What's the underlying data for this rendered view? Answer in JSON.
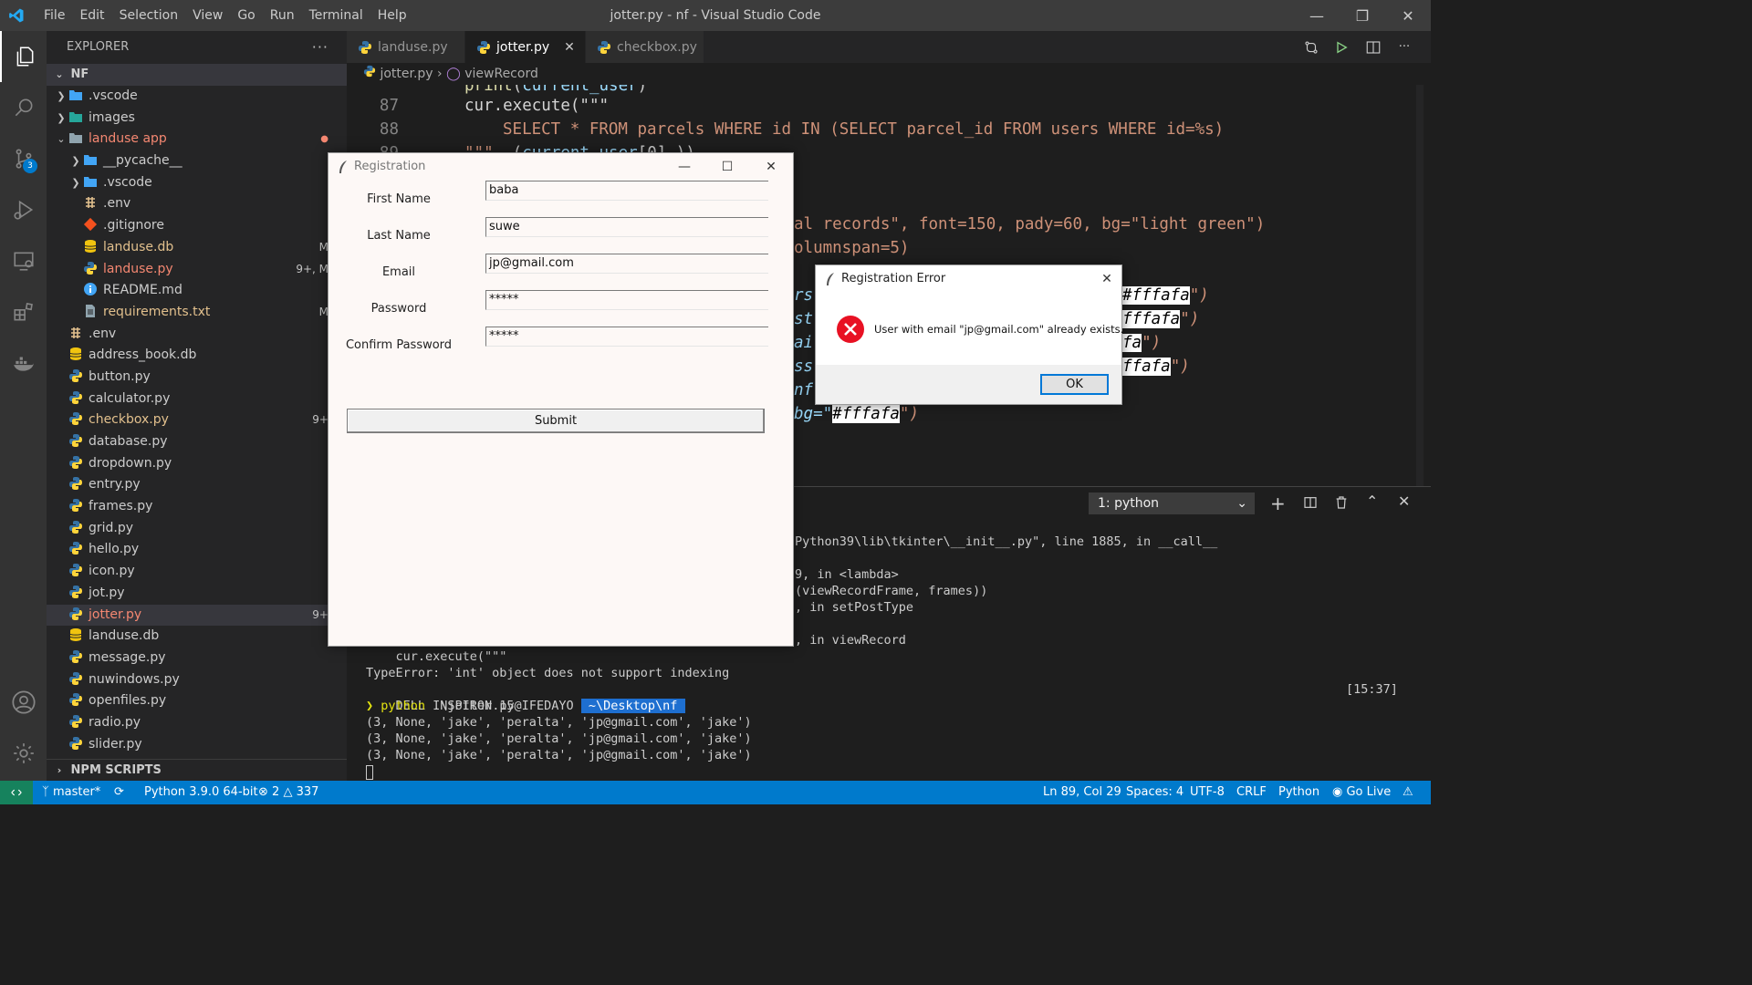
{
  "titlebar": {
    "menu": [
      "File",
      "Edit",
      "Selection",
      "View",
      "Go",
      "Run",
      "Terminal",
      "Help"
    ],
    "title": "jotter.py - nf - Visual Studio Code"
  },
  "activitybar": {
    "scm_badge": "3"
  },
  "sidebar": {
    "header": "EXPLORER",
    "root": "NF",
    "items": [
      {
        "name": ".vscode",
        "kind": "folder-blue",
        "depth": 1,
        "chev": "right",
        "color": "normal",
        "status": ""
      },
      {
        "name": "images",
        "kind": "folder-green",
        "depth": 1,
        "chev": "right",
        "color": "normal",
        "status": ""
      },
      {
        "name": "landuse app",
        "kind": "folder",
        "depth": 1,
        "chev": "down",
        "color": "red",
        "status": "dot"
      },
      {
        "name": "__pycache__",
        "kind": "folder-blue",
        "depth": 2,
        "chev": "right",
        "color": "normal",
        "status": ""
      },
      {
        "name": ".vscode",
        "kind": "folder-blue",
        "depth": 2,
        "chev": "right",
        "color": "normal",
        "status": ""
      },
      {
        "name": ".env",
        "kind": "env",
        "depth": 2,
        "chev": "",
        "color": "normal",
        "status": ""
      },
      {
        "name": ".gitignore",
        "kind": "git",
        "depth": 2,
        "chev": "",
        "color": "normal",
        "status": ""
      },
      {
        "name": "landuse.db",
        "kind": "db",
        "depth": 2,
        "chev": "",
        "color": "yellow",
        "status": "M"
      },
      {
        "name": "landuse.py",
        "kind": "py",
        "depth": 2,
        "chev": "",
        "color": "red",
        "status": "9+, M"
      },
      {
        "name": "README.md",
        "kind": "info",
        "depth": 2,
        "chev": "",
        "color": "normal",
        "status": ""
      },
      {
        "name": "requirements.txt",
        "kind": "txt",
        "depth": 2,
        "chev": "",
        "color": "yellow",
        "status": "M"
      },
      {
        "name": ".env",
        "kind": "env",
        "depth": 1,
        "chev": "",
        "color": "normal",
        "status": ""
      },
      {
        "name": "address_book.db",
        "kind": "db",
        "depth": 1,
        "chev": "",
        "color": "normal",
        "status": ""
      },
      {
        "name": "button.py",
        "kind": "py",
        "depth": 1,
        "chev": "",
        "color": "normal",
        "status": ""
      },
      {
        "name": "calculator.py",
        "kind": "py",
        "depth": 1,
        "chev": "",
        "color": "normal",
        "status": ""
      },
      {
        "name": "checkbox.py",
        "kind": "py",
        "depth": 1,
        "chev": "",
        "color": "yellow",
        "status": "9+"
      },
      {
        "name": "database.py",
        "kind": "py",
        "depth": 1,
        "chev": "",
        "color": "normal",
        "status": ""
      },
      {
        "name": "dropdown.py",
        "kind": "py",
        "depth": 1,
        "chev": "",
        "color": "normal",
        "status": ""
      },
      {
        "name": "entry.py",
        "kind": "py",
        "depth": 1,
        "chev": "",
        "color": "normal",
        "status": ""
      },
      {
        "name": "frames.py",
        "kind": "py",
        "depth": 1,
        "chev": "",
        "color": "normal",
        "status": ""
      },
      {
        "name": "grid.py",
        "kind": "py",
        "depth": 1,
        "chev": "",
        "color": "normal",
        "status": ""
      },
      {
        "name": "hello.py",
        "kind": "py",
        "depth": 1,
        "chev": "",
        "color": "normal",
        "status": ""
      },
      {
        "name": "icon.py",
        "kind": "py",
        "depth": 1,
        "chev": "",
        "color": "normal",
        "status": ""
      },
      {
        "name": "jot.py",
        "kind": "py",
        "depth": 1,
        "chev": "",
        "color": "normal",
        "status": ""
      },
      {
        "name": "jotter.py",
        "kind": "py",
        "depth": 1,
        "chev": "",
        "color": "red",
        "status": "9+",
        "selected": true
      },
      {
        "name": "landuse.db",
        "kind": "db",
        "depth": 1,
        "chev": "",
        "color": "normal",
        "status": ""
      },
      {
        "name": "message.py",
        "kind": "py",
        "depth": 1,
        "chev": "",
        "color": "normal",
        "status": ""
      },
      {
        "name": "nuwindows.py",
        "kind": "py",
        "depth": 1,
        "chev": "",
        "color": "normal",
        "status": ""
      },
      {
        "name": "openfiles.py",
        "kind": "py",
        "depth": 1,
        "chev": "",
        "color": "normal",
        "status": ""
      },
      {
        "name": "radio.py",
        "kind": "py",
        "depth": 1,
        "chev": "",
        "color": "normal",
        "status": ""
      },
      {
        "name": "slider.py",
        "kind": "py",
        "depth": 1,
        "chev": "",
        "color": "normal",
        "status": ""
      }
    ],
    "npm_section": "NPM SCRIPTS"
  },
  "tabs": [
    {
      "label": "landuse.py",
      "active": false
    },
    {
      "label": "jotter.py",
      "active": true
    },
    {
      "label": "checkbox.py",
      "active": false
    }
  ],
  "breadcrumb": {
    "file": "jotter.py",
    "symbol": "viewRecord"
  },
  "code": {
    "line87_num": "87",
    "line88_num": "88",
    "line89_num": "89",
    "line87": "cur.execute(\"\"\"",
    "line88": "SELECT * FROM parcels WHERE id IN (SELECT parcel_id FROM users WHERE id=%s)",
    "frag_records": "al records\", font=150, pady=60, bg=\"light green\")",
    "frag_colspan": "olumnspan=5)",
    "frag_hex": "#fffafa",
    "frag_bg": "bg=\"",
    "frag_bg_end": "\")"
  },
  "terminal": {
    "selector": "1: python",
    "lines": [
      "Python39\\lib\\tkinter\\__init__.py\", line 1885, in __call__",
      "9, in <lambda>",
      "(viewRecordFrame, frames))",
      ", in setPostType",
      ", in viewRecord",
      "    cur.execute(\"\"\"",
      "TypeError: 'int' object does not support indexing"
    ],
    "prompt_user": "DELL INSPIRON 15@IFEDAYO",
    "prompt_path": " ~\\Desktop\\nf ",
    "time": "[15:37]",
    "command": "python .\\jotter.py",
    "outputs": [
      "(3, None, 'jake', 'peralta', 'jp@gmail.com', 'jake')",
      "(3, None, 'jake', 'peralta', 'jp@gmail.com', 'jake')",
      "(3, None, 'jake', 'peralta', 'jp@gmail.com', 'jake')"
    ]
  },
  "statusbar": {
    "branch": "master*",
    "python": "Python 3.9.0 64-bit",
    "errors": "2",
    "warnings": "337",
    "position": "Ln 89, Col 29",
    "spaces": "Spaces: 4",
    "encoding": "UTF-8",
    "eol": "CRLF",
    "language": "Python",
    "golive": "Go Live"
  },
  "registration": {
    "title": "Registration",
    "fields": [
      {
        "label": "First Name",
        "value": "baba"
      },
      {
        "label": "Last Name",
        "value": "suwe"
      },
      {
        "label": "Email",
        "value": "jp@gmail.com"
      },
      {
        "label": "Password",
        "value": "*****"
      },
      {
        "label": "Confirm Password",
        "value": "*****"
      }
    ],
    "submit": "Submit"
  },
  "error_dialog": {
    "title": "Registration Error",
    "message": "User with email \"jp@gmail.com\" already exists.",
    "ok": "OK"
  },
  "colors": {
    "accent": "#007acc",
    "python_blue": "#3572a5",
    "python_yellow": "#ffd43b",
    "error_red": "#e81123"
  }
}
